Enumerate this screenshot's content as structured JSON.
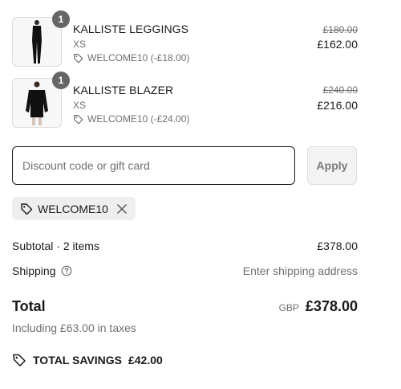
{
  "items": [
    {
      "name": "KALLISTE LEGGINGS",
      "size": "XS",
      "quantity": "1",
      "discount": "WELCOME10 (-£18.00)",
      "original_price": "£180.00",
      "price": "£162.00",
      "icon": "tag-icon"
    },
    {
      "name": "KALLISTE BLAZER",
      "size": "XS",
      "quantity": "1",
      "discount": "WELCOME10 (-£24.00)",
      "original_price": "£240.00",
      "price": "£216.00",
      "icon": "tag-icon"
    }
  ],
  "discount_form": {
    "placeholder": "Discount code or gift card",
    "value": "",
    "apply_label": "Apply"
  },
  "applied_code": {
    "code": "WELCOME10",
    "remove_icon": "close-icon"
  },
  "summary": {
    "subtotal_label": "Subtotal · 2 items",
    "subtotal_value": "£378.00",
    "shipping_label": "Shipping",
    "shipping_value": "Enter shipping address",
    "total_label": "Total",
    "currency": "GBP",
    "total_value": "£378.00",
    "taxes_note": "Including £63.00 in taxes",
    "savings_label": "TOTAL SAVINGS",
    "savings_value": "£42.00"
  },
  "colors": {
    "badge": "#666666",
    "muted_text": "#707070",
    "chip_bg": "#eeeeee",
    "button_bg": "#f3f3f3"
  }
}
